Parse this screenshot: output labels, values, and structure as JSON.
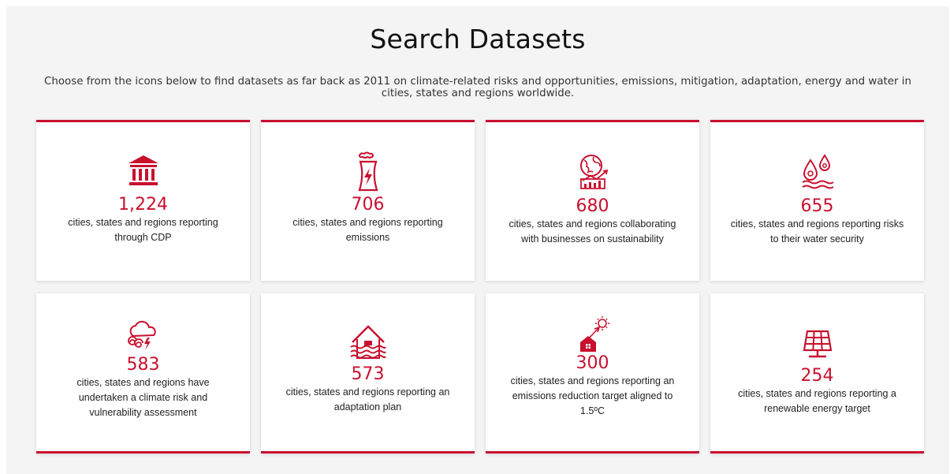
{
  "header": {
    "title": "Search Datasets",
    "subtitle": "Choose from the icons below to find datasets as far back as 2011 on climate-related risks and opportunities, emissions, mitigation, adaptation, energy and water in cities, states and regions worldwide."
  },
  "colors": {
    "accent": "#c8102e",
    "panel": "#f4f4f4"
  },
  "cards": [
    {
      "icon": "government-building-icon",
      "value": "1,224",
      "label": "cities, states and regions reporting through CDP"
    },
    {
      "icon": "power-plant-icon",
      "value": "706",
      "label": "cities, states and regions reporting emissions"
    },
    {
      "icon": "globe-chart-icon",
      "value": "680",
      "label": "cities, states and regions collaborating with businesses on sustainability"
    },
    {
      "icon": "water-drops-icon",
      "value": "655",
      "label": "cities, states and regions reporting risks to their water security"
    },
    {
      "icon": "storm-cloud-icon",
      "value": "583",
      "label": "cities, states and regions have undertaken a climate risk and vulnerability assessment"
    },
    {
      "icon": "flooded-house-icon",
      "value": "573",
      "label": "cities, states and regions reporting an adaptation plan"
    },
    {
      "icon": "house-sun-target-icon",
      "value": "300",
      "label": "cities, states and regions reporting an emissions reduction target aligned to 1.5ºC"
    },
    {
      "icon": "solar-panel-icon",
      "value": "254",
      "label": "cities, states and regions reporting a renewable energy target"
    }
  ]
}
